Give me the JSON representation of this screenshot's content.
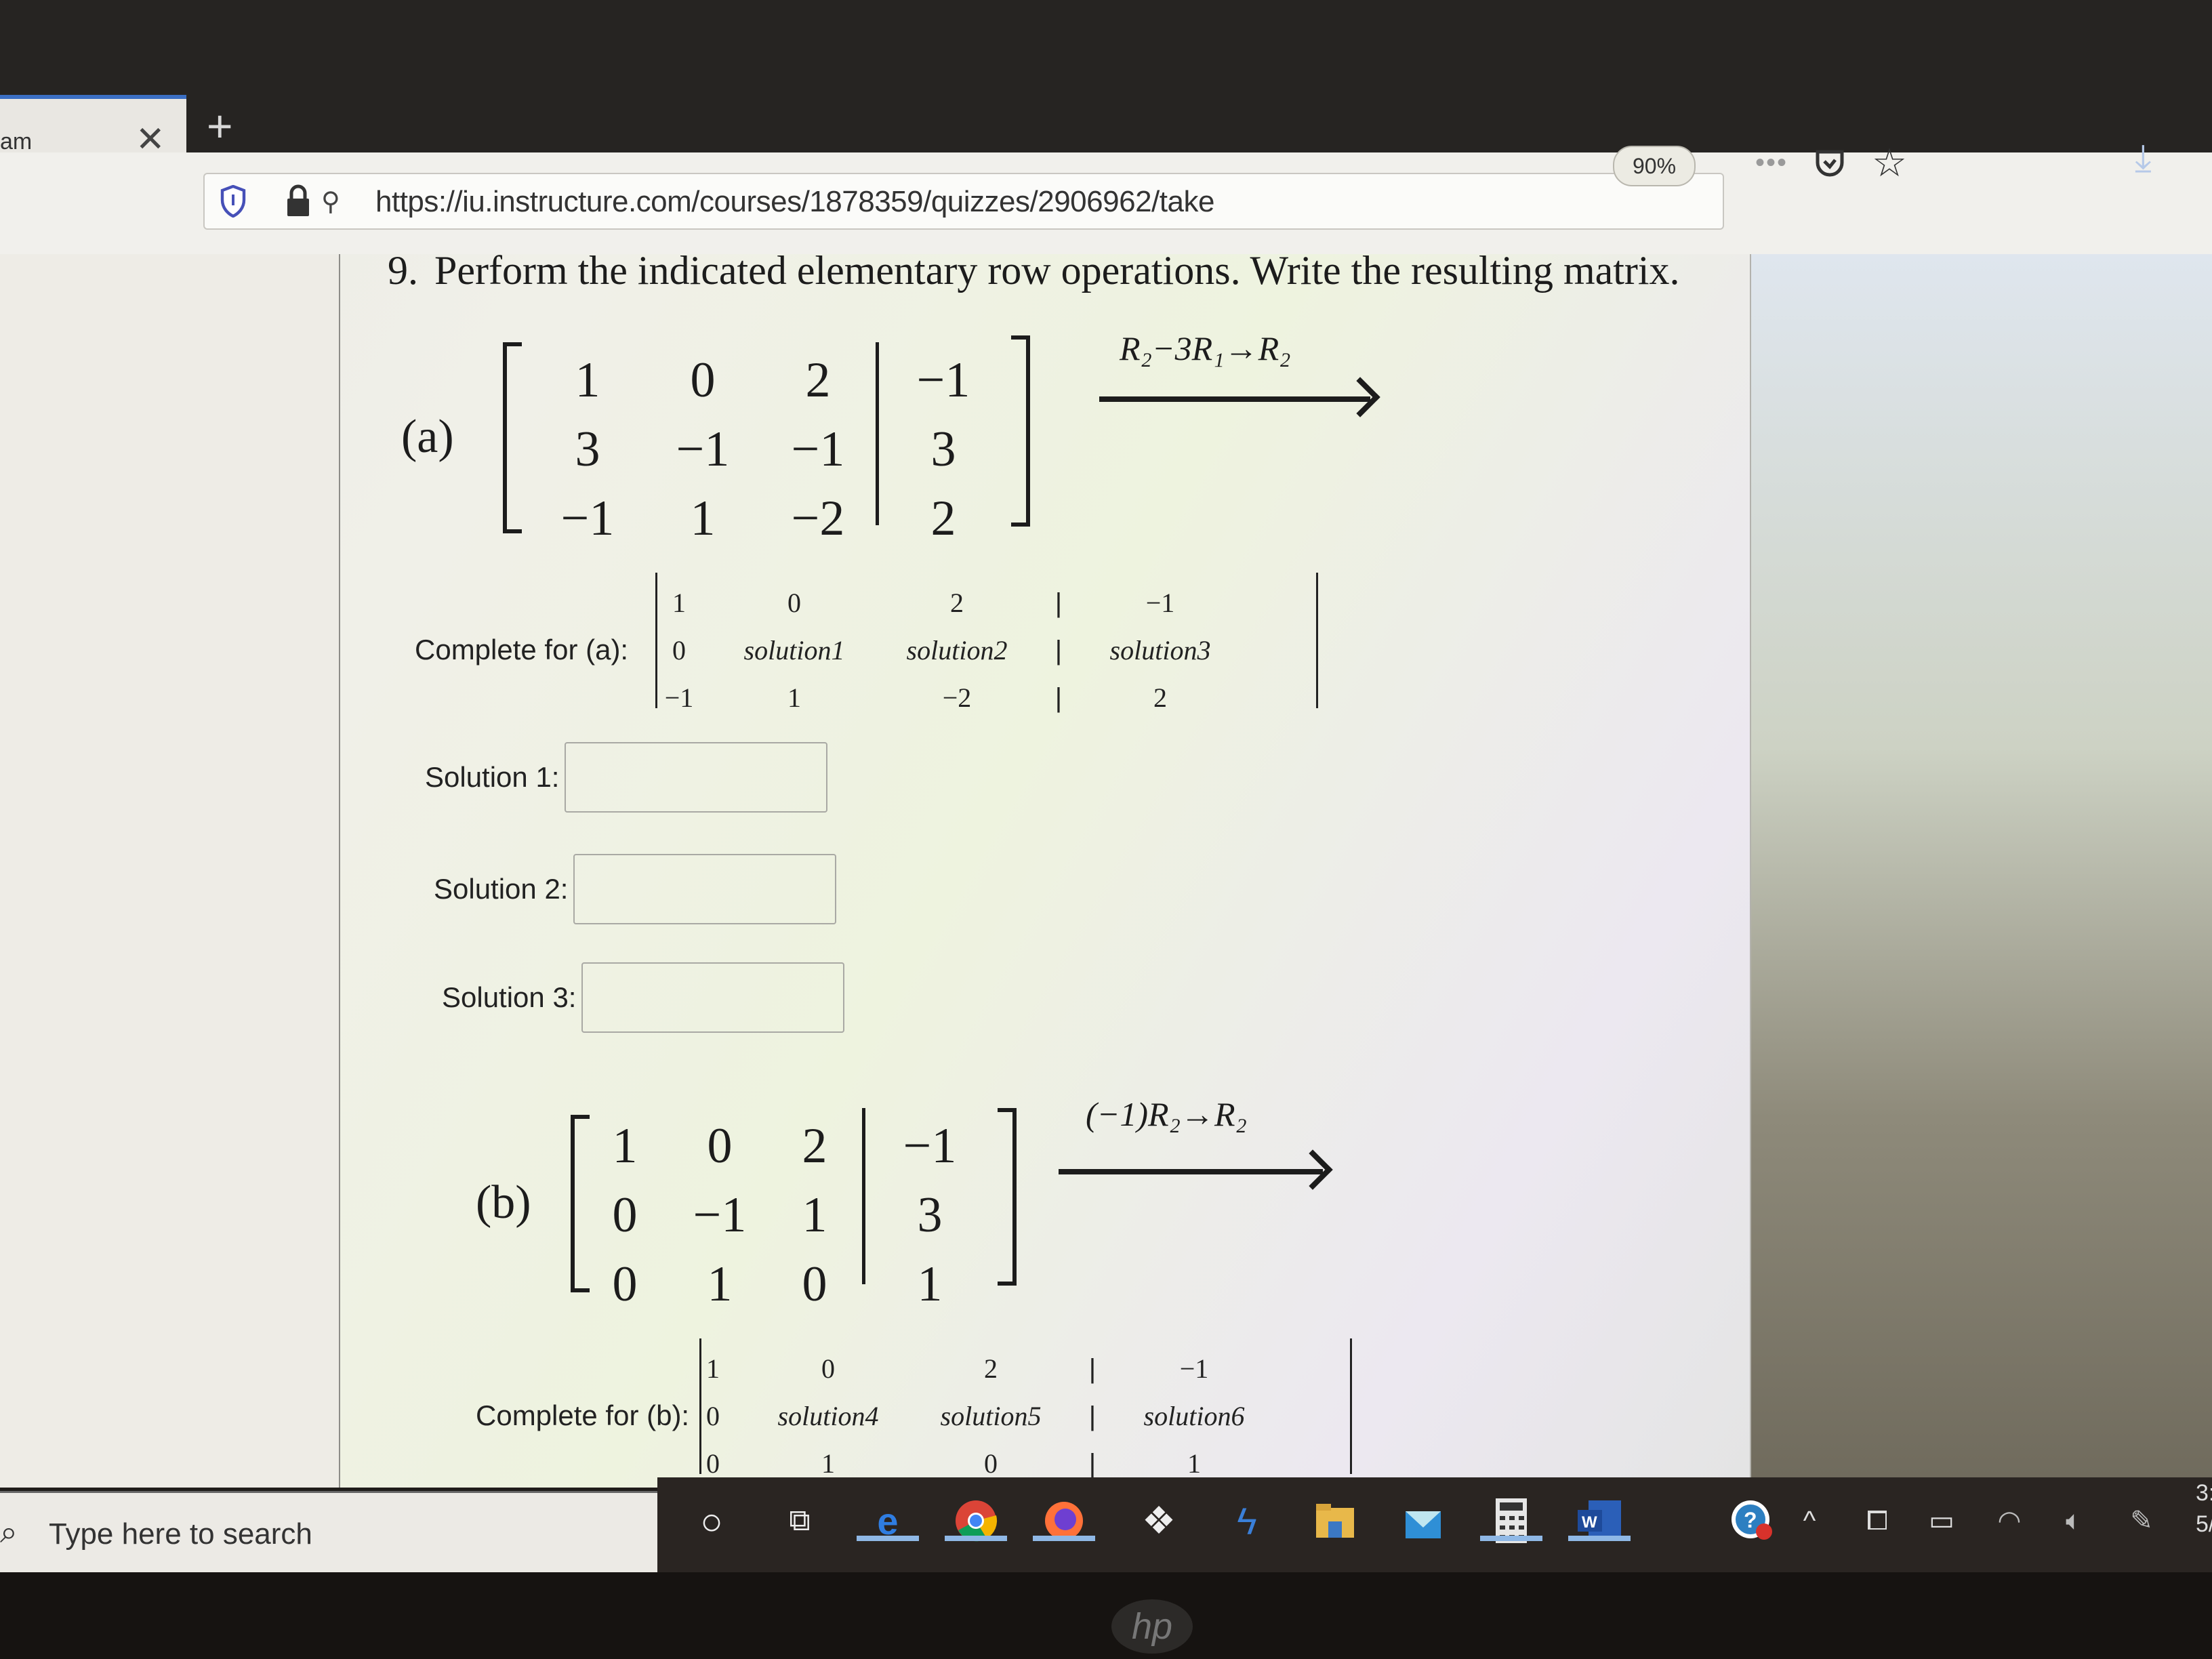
{
  "browser": {
    "tab_title": "am",
    "url": "https://iu.instructure.com/courses/1878359/quizzes/2906962/take",
    "zoom": "90%",
    "icons": [
      "shield-icon",
      "lock-icon",
      "permissions-icon",
      "more-icon",
      "pocket-icon",
      "star-icon",
      "download-icon"
    ]
  },
  "question": {
    "number": "9.",
    "title": "Perform the indicated elementary row operations. Write the resulting matrix."
  },
  "part_a": {
    "label": "(a)",
    "matrix": [
      [
        "1",
        "0",
        "2",
        "−1"
      ],
      [
        "3",
        "−1",
        "−1",
        "3"
      ],
      [
        "−1",
        "1",
        "−2",
        "2"
      ]
    ],
    "operation": "R₂−3R₁→R₂",
    "complete_label": "Complete for (a):",
    "complete_matrix": [
      [
        "1",
        "0",
        "2",
        "|",
        "−1"
      ],
      [
        "0",
        "solution1",
        "solution2",
        "|",
        "solution3"
      ],
      [
        "−1",
        "1",
        "−2",
        "|",
        "2"
      ]
    ],
    "solutions": [
      {
        "label": "Solution 1:",
        "value": ""
      },
      {
        "label": "Solution 2:",
        "value": ""
      },
      {
        "label": "Solution 3:",
        "value": ""
      }
    ]
  },
  "part_b": {
    "label": "(b)",
    "matrix": [
      [
        "1",
        "0",
        "2",
        "−1"
      ],
      [
        "0",
        "−1",
        "1",
        "3"
      ],
      [
        "0",
        "1",
        "0",
        "1"
      ]
    ],
    "operation": "(−1)R₂→R₂",
    "complete_label": "Complete for (b):",
    "complete_matrix": [
      [
        "1",
        "0",
        "2",
        "|",
        "−1"
      ],
      [
        "0",
        "solution4",
        "solution5",
        "|",
        "solution6"
      ],
      [
        "0",
        "1",
        "0",
        "|",
        "1"
      ]
    ]
  },
  "taskbar": {
    "search_placeholder": "Type here to search",
    "apps": [
      "cortana-icon",
      "task-view-icon",
      "edge-icon",
      "chrome-icon",
      "firefox-icon",
      "dropbox-icon",
      "app-icon",
      "file-explorer-icon",
      "mail-icon",
      "calculator-icon",
      "word-icon",
      "help-icon"
    ],
    "clock_partial": [
      "3:",
      "5/"
    ]
  },
  "colors": {
    "accent": "#3b6fc4",
    "text": "#1c1c1c"
  }
}
